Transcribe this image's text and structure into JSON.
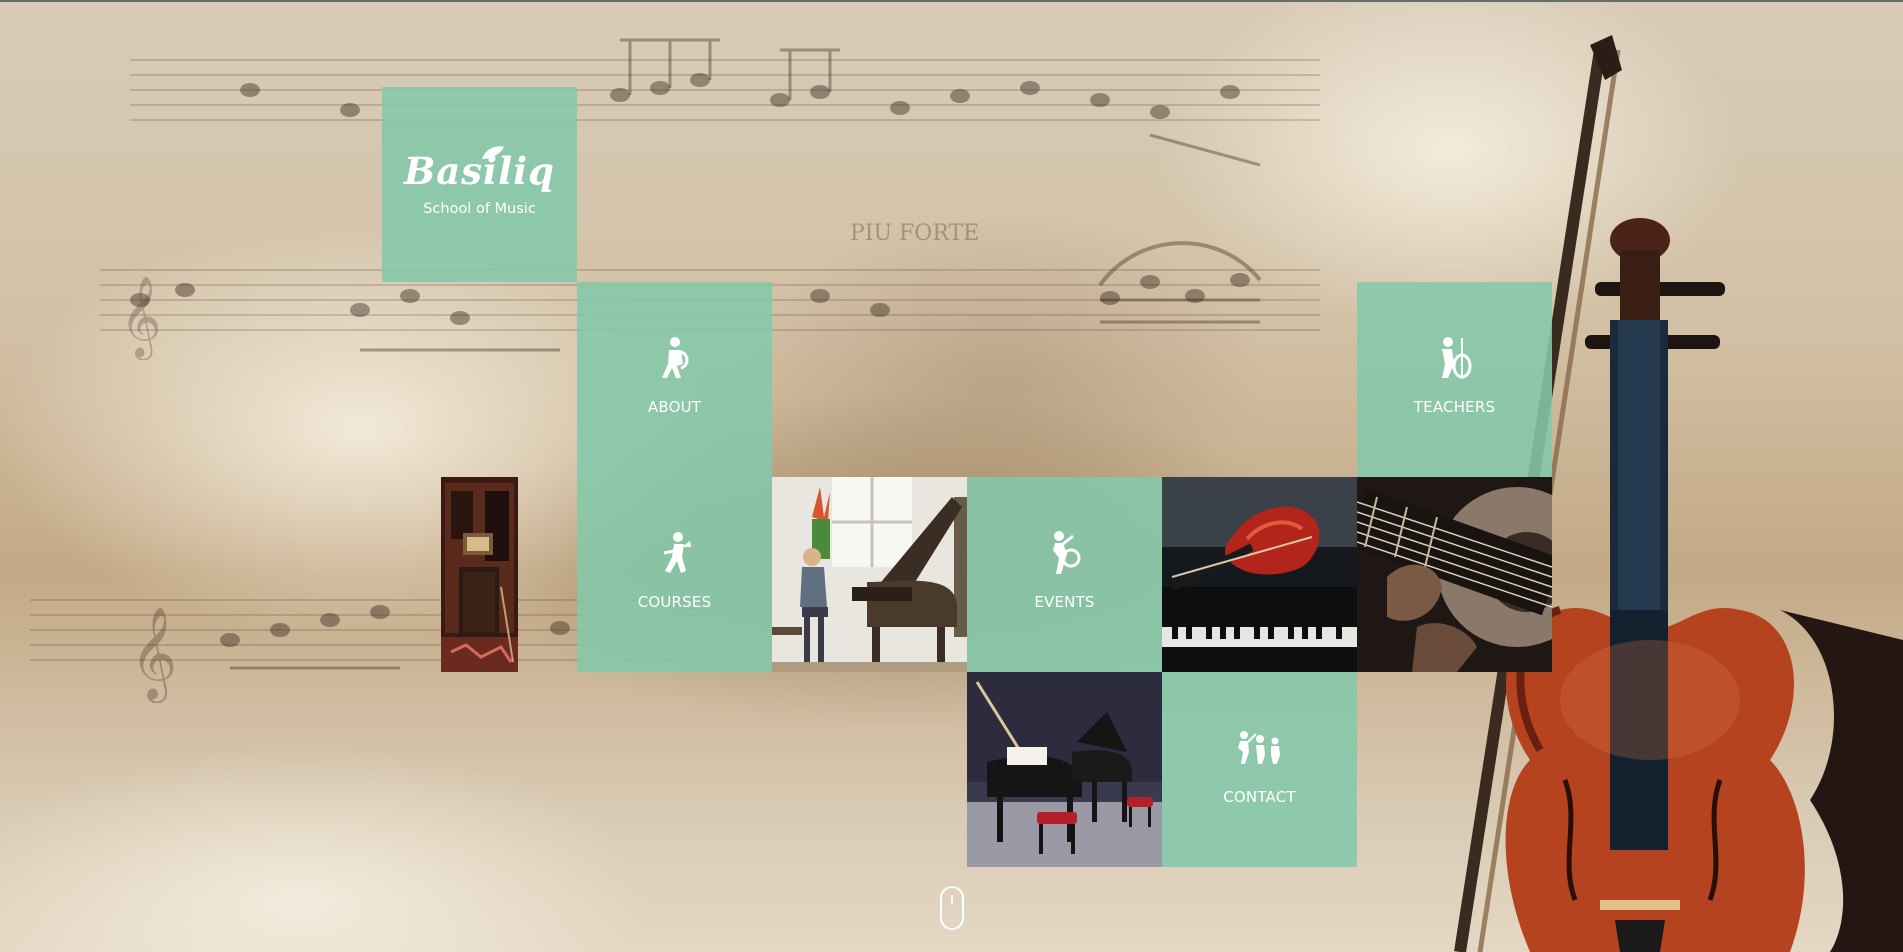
{
  "brand": {
    "name": "Basiliq",
    "tagline": "School of Music"
  },
  "nav": {
    "about": {
      "label": "ABOUT",
      "icon": "saxophone-player-icon"
    },
    "courses": {
      "label": "COURSES",
      "icon": "trumpet-player-icon"
    },
    "teachers": {
      "label": "TEACHERS",
      "icon": "cellist-icon"
    },
    "events": {
      "label": "EVENTS",
      "icon": "dancer-with-tambourine-icon"
    },
    "contact": {
      "label": "CONTACT",
      "icon": "band-group-icon"
    }
  },
  "photos": [
    {
      "name": "recording-studio-photo"
    },
    {
      "name": "woman-playing-piano-photo"
    },
    {
      "name": "violin-on-piano-photo"
    },
    {
      "name": "guitar-strings-closeup-photo"
    },
    {
      "name": "grand-pianos-on-stage-photo"
    }
  ],
  "scroll": {
    "icon": "mouse-scroll-icon"
  },
  "colors": {
    "tile_green": "#84C8AA",
    "text": "#FFFFFF",
    "background": "#CDBBA0"
  }
}
